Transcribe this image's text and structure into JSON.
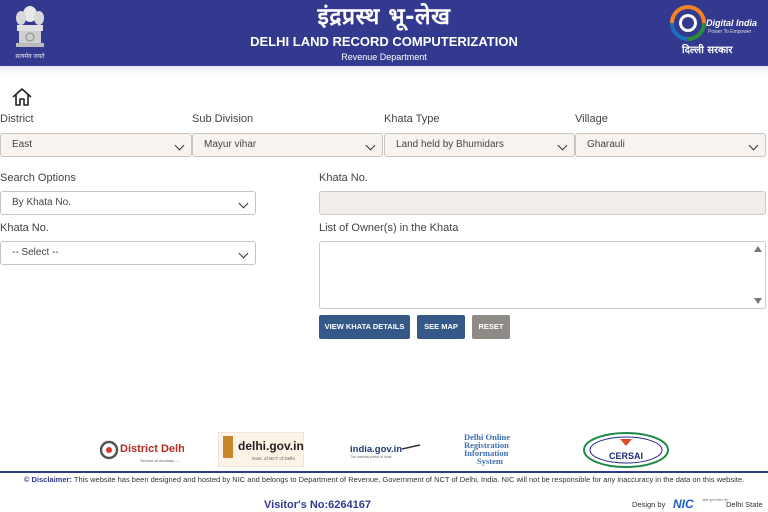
{
  "header": {
    "emblem_caption": "सत्यमेव जयते",
    "hindi_title": "इंद्रप्रस्थ भू-लेख",
    "title": "DELHI LAND RECORD COMPUTERIZATION",
    "subtitle": "Revenue Department",
    "digital_india": "Digital India",
    "digital_india_tag": "Power To Empower",
    "delhi_sarkar": "दिल्ली सरकार"
  },
  "form": {
    "district": {
      "label": "District",
      "value": "East"
    },
    "sub_division": {
      "label": "Sub Division",
      "value": "Mayur vihar"
    },
    "khata_type": {
      "label": "Khata Type",
      "value": "Land held by Bhumidars"
    },
    "village": {
      "label": "Village",
      "value": "Gharauli"
    },
    "search_options": {
      "label": "Search Options",
      "value": "By Khata No."
    },
    "khata_no_input": {
      "label": "Khata No.",
      "value": ""
    },
    "khata_no_select": {
      "label": "Khata No.",
      "value": "-- Select --"
    },
    "owners": {
      "label": "List of Owner(s) in the Khata",
      "value": ""
    }
  },
  "buttons": {
    "view": "VIEW KHATA DETAILS",
    "map": "SEE MAP",
    "reset": "RESET"
  },
  "footer_logos": {
    "district_delhi": "District Delhi",
    "district_delhi_tag": "Service at doorstep......",
    "delhi_gov": "delhi.gov.in",
    "delhi_gov_tag": "Govt. of NCT of Delhi",
    "india_gov": "india.gov.in",
    "india_gov_tag": "The national portal of India",
    "doris": [
      "Delhi Online",
      "Registration",
      "Information",
      "System"
    ],
    "cersai": "CERSAI"
  },
  "footer": {
    "disclaimer_label": "© Disclaimer:",
    "disclaimer_text": " This website has been designed and hosted by NIC and belongs to Department of Revenue, Government of NCT of Delhi, India. NIC will not be responsible for any inaccuracy in the data on this website.",
    "visitors": "Visitor's No:6264167",
    "design_by": "Design by",
    "nic": "NIC",
    "nic_small": "राष्ट्रीय सूचना विज्ञान केंद्र",
    "delhi_state": "Delhi State"
  },
  "colors": {
    "header": "#33398f",
    "button": "#345887",
    "reset": "#8e8a86"
  },
  "icons": {
    "home": "home-icon",
    "chevron": "chevron-down-icon"
  }
}
